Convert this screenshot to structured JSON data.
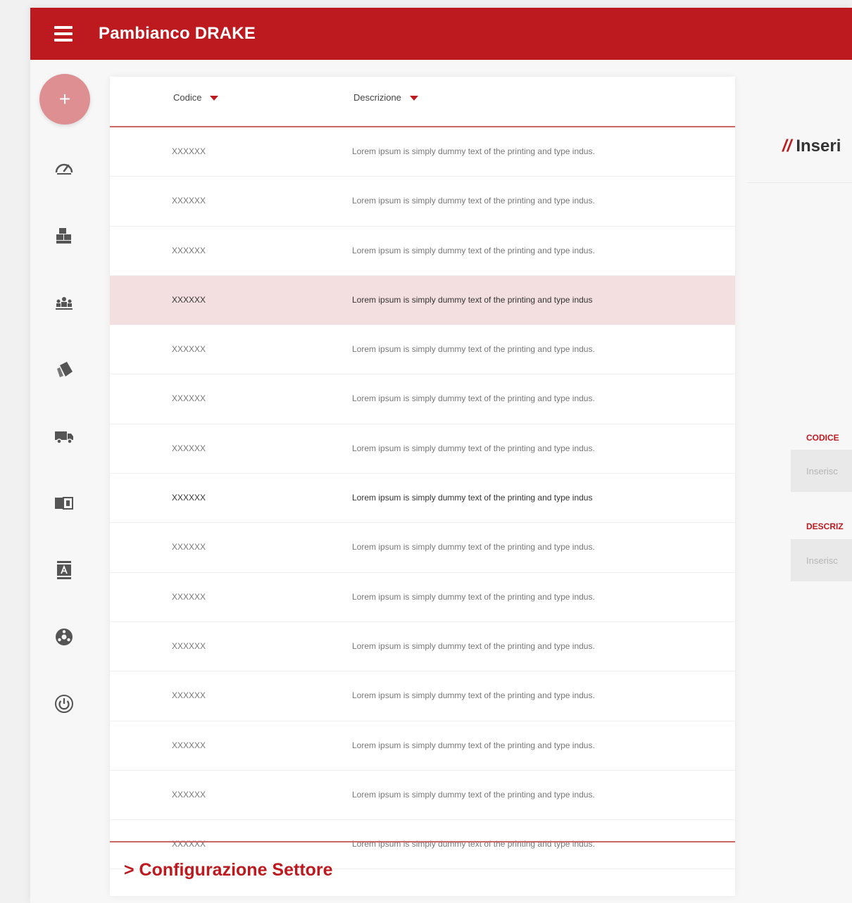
{
  "header": {
    "title": "Pambianco DRAKE",
    "menu_icon": "hamburger-icon"
  },
  "sidebar": {
    "fab_label": "+",
    "icons": [
      "dashboard-icon",
      "warehouse-icon",
      "team-icon",
      "labels-icon",
      "truck-icon",
      "card-icon",
      "font-book-icon",
      "settings-icon",
      "power-icon"
    ]
  },
  "table": {
    "columns": [
      {
        "label": "Codice"
      },
      {
        "label": "Descrizione"
      }
    ],
    "rows": [
      {
        "code": "XXXXXX",
        "desc": "Lorem ipsum is simply dummy text of the printing and type indus."
      },
      {
        "code": "XXXXXX",
        "desc": "Lorem ipsum is simply dummy text of the printing and type indus."
      },
      {
        "code": "XXXXXX",
        "desc": "Lorem ipsum is simply dummy text of the printing and type indus."
      },
      {
        "code": "XXXXXX",
        "desc": "Lorem ipsum is simply dummy text of the printing and type indus"
      },
      {
        "code": "XXXXXX",
        "desc": "Lorem ipsum is simply dummy text of the printing and type indus."
      },
      {
        "code": "XXXXXX",
        "desc": "Lorem ipsum is simply dummy text of the printing and type indus."
      },
      {
        "code": "XXXXXX",
        "desc": "Lorem ipsum is simply dummy text of the printing and type indus."
      },
      {
        "code": "XXXXXX",
        "desc": "Lorem ipsum is simply dummy text of the printing and type indus"
      },
      {
        "code": "XXXXXX",
        "desc": "Lorem ipsum is simply dummy text of the printing and type indus."
      },
      {
        "code": "XXXXXX",
        "desc": "Lorem ipsum is simply dummy text of the printing and type indus."
      },
      {
        "code": "XXXXXX",
        "desc": "Lorem ipsum is simply dummy text of the printing and type indus."
      },
      {
        "code": "XXXXXX",
        "desc": "Lorem ipsum is simply dummy text of the printing and type indus."
      },
      {
        "code": "XXXXXX",
        "desc": "Lorem ipsum is simply dummy text of the printing and type indus."
      },
      {
        "code": "XXXXXX",
        "desc": "Lorem ipsum is simply dummy text of the printing and type indus."
      },
      {
        "code": "XXXXXX",
        "desc": "Lorem ipsum is simply dummy text of the printing and type indus."
      }
    ],
    "selected_row": 4,
    "bold_row": 8,
    "footer_title": "> Configurazione Settore"
  },
  "form": {
    "title_prefix": "//",
    "title": "Inseri",
    "fields": [
      {
        "label": "CODICE",
        "placeholder": "Inserisc"
      },
      {
        "label": "DESCRIZ",
        "placeholder": "Inserisc"
      }
    ]
  },
  "colors": {
    "brand": "#bd1a1f",
    "fab": "#dd8f92",
    "selected_row": "#f4dfe0"
  }
}
